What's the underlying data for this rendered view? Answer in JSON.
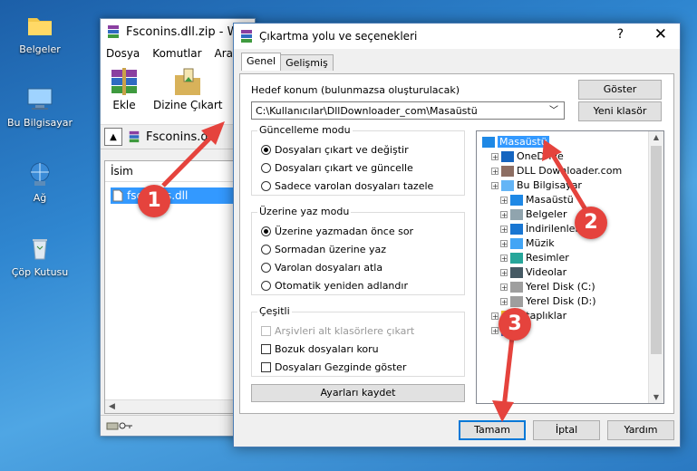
{
  "desktop": {
    "icons": [
      {
        "label": "Belgeler",
        "icon": "folder-icon"
      },
      {
        "label": "Bu Bilgisayar",
        "icon": "computer-icon"
      },
      {
        "label": "Ağ",
        "icon": "network-icon"
      },
      {
        "label": "Çöp Kutusu",
        "icon": "recycle-bin-icon"
      }
    ]
  },
  "winrar": {
    "title": "Fsconins.dll.zip - Wi",
    "menu": [
      "Dosya",
      "Komutlar",
      "Araçla"
    ],
    "toolbar": [
      {
        "label": "Ekle"
      },
      {
        "label": "Dizine Çıkart"
      }
    ],
    "path": "Fsconins.dl",
    "column_header": "İsim",
    "file": "fsconins.dll"
  },
  "dialog": {
    "title": "Çıkartma yolu ve seçenekleri",
    "help": "?",
    "close": "✕",
    "tabs": [
      "Genel",
      "Gelişmiş"
    ],
    "destination_label": "Hedef konum (bulunmazsa oluşturulacak)",
    "destination_value": "C:\\Kullanıcılar\\DllDownloader_com\\Masaüstü",
    "buttons": {
      "show": "Göster",
      "new_folder": "Yeni klasör",
      "save_settings": "Ayarları kaydet",
      "ok": "Tamam",
      "cancel": "İptal",
      "help": "Yardım"
    },
    "update_mode": {
      "title": "Güncelleme modu",
      "options": [
        {
          "label": "Dosyaları çıkart ve değiştir",
          "selected": true
        },
        {
          "label": "Dosyaları çıkart ve güncelle",
          "selected": false
        },
        {
          "label": "Sadece varolan dosyaları tazele",
          "selected": false
        }
      ]
    },
    "overwrite_mode": {
      "title": "Üzerine yaz modu",
      "options": [
        {
          "label": "Üzerine yazmadan önce sor",
          "selected": true
        },
        {
          "label": "Sormadan üzerine yaz",
          "selected": false
        },
        {
          "label": "Varolan dosyaları atla",
          "selected": false
        },
        {
          "label": "Otomatik yeniden adlandır",
          "selected": false
        }
      ]
    },
    "misc": {
      "title": "Çeşitli",
      "options": [
        {
          "label": "Arşivleri alt klasörlere çıkart",
          "checked": false,
          "disabled": true
        },
        {
          "label": "Bozuk dosyaları koru",
          "checked": false,
          "disabled": false
        },
        {
          "label": "Dosyaları Gezginde göster",
          "checked": false,
          "disabled": false
        }
      ]
    },
    "tree": [
      {
        "label": "Masaüstü",
        "level": 0,
        "selected": true,
        "icon": "desktop-icon"
      },
      {
        "label": "OneDrive",
        "level": 1,
        "icon": "cloud-icon"
      },
      {
        "label": "DLL Downloader.com",
        "level": 1,
        "icon": "user-icon"
      },
      {
        "label": "Bu Bilgisayar",
        "level": 1,
        "icon": "computer-icon"
      },
      {
        "label": "Masaüstü",
        "level": 2,
        "icon": "desktop-icon"
      },
      {
        "label": "Belgeler",
        "level": 2,
        "icon": "document-icon"
      },
      {
        "label": "İndirilenler",
        "level": 2,
        "icon": "download-icon"
      },
      {
        "label": "Müzik",
        "level": 2,
        "icon": "music-icon"
      },
      {
        "label": "Resimler",
        "level": 2,
        "icon": "pictures-icon"
      },
      {
        "label": "Videolar",
        "level": 2,
        "icon": "video-icon"
      },
      {
        "label": "Yerel Disk (C:)",
        "level": 2,
        "icon": "disk-icon"
      },
      {
        "label": "Yerel Disk (D:)",
        "level": 2,
        "icon": "disk-icon"
      },
      {
        "label": "Kitaplıklar",
        "level": 1,
        "icon": "library-icon"
      },
      {
        "label": "",
        "level": 1,
        "icon": "network-icon"
      }
    ]
  },
  "annotations": [
    {
      "number": "1"
    },
    {
      "number": "2"
    },
    {
      "number": "3"
    }
  ],
  "colors": {
    "accent": "#e5433d",
    "selection": "#3399ff",
    "default_button_border": "#0078d7"
  }
}
